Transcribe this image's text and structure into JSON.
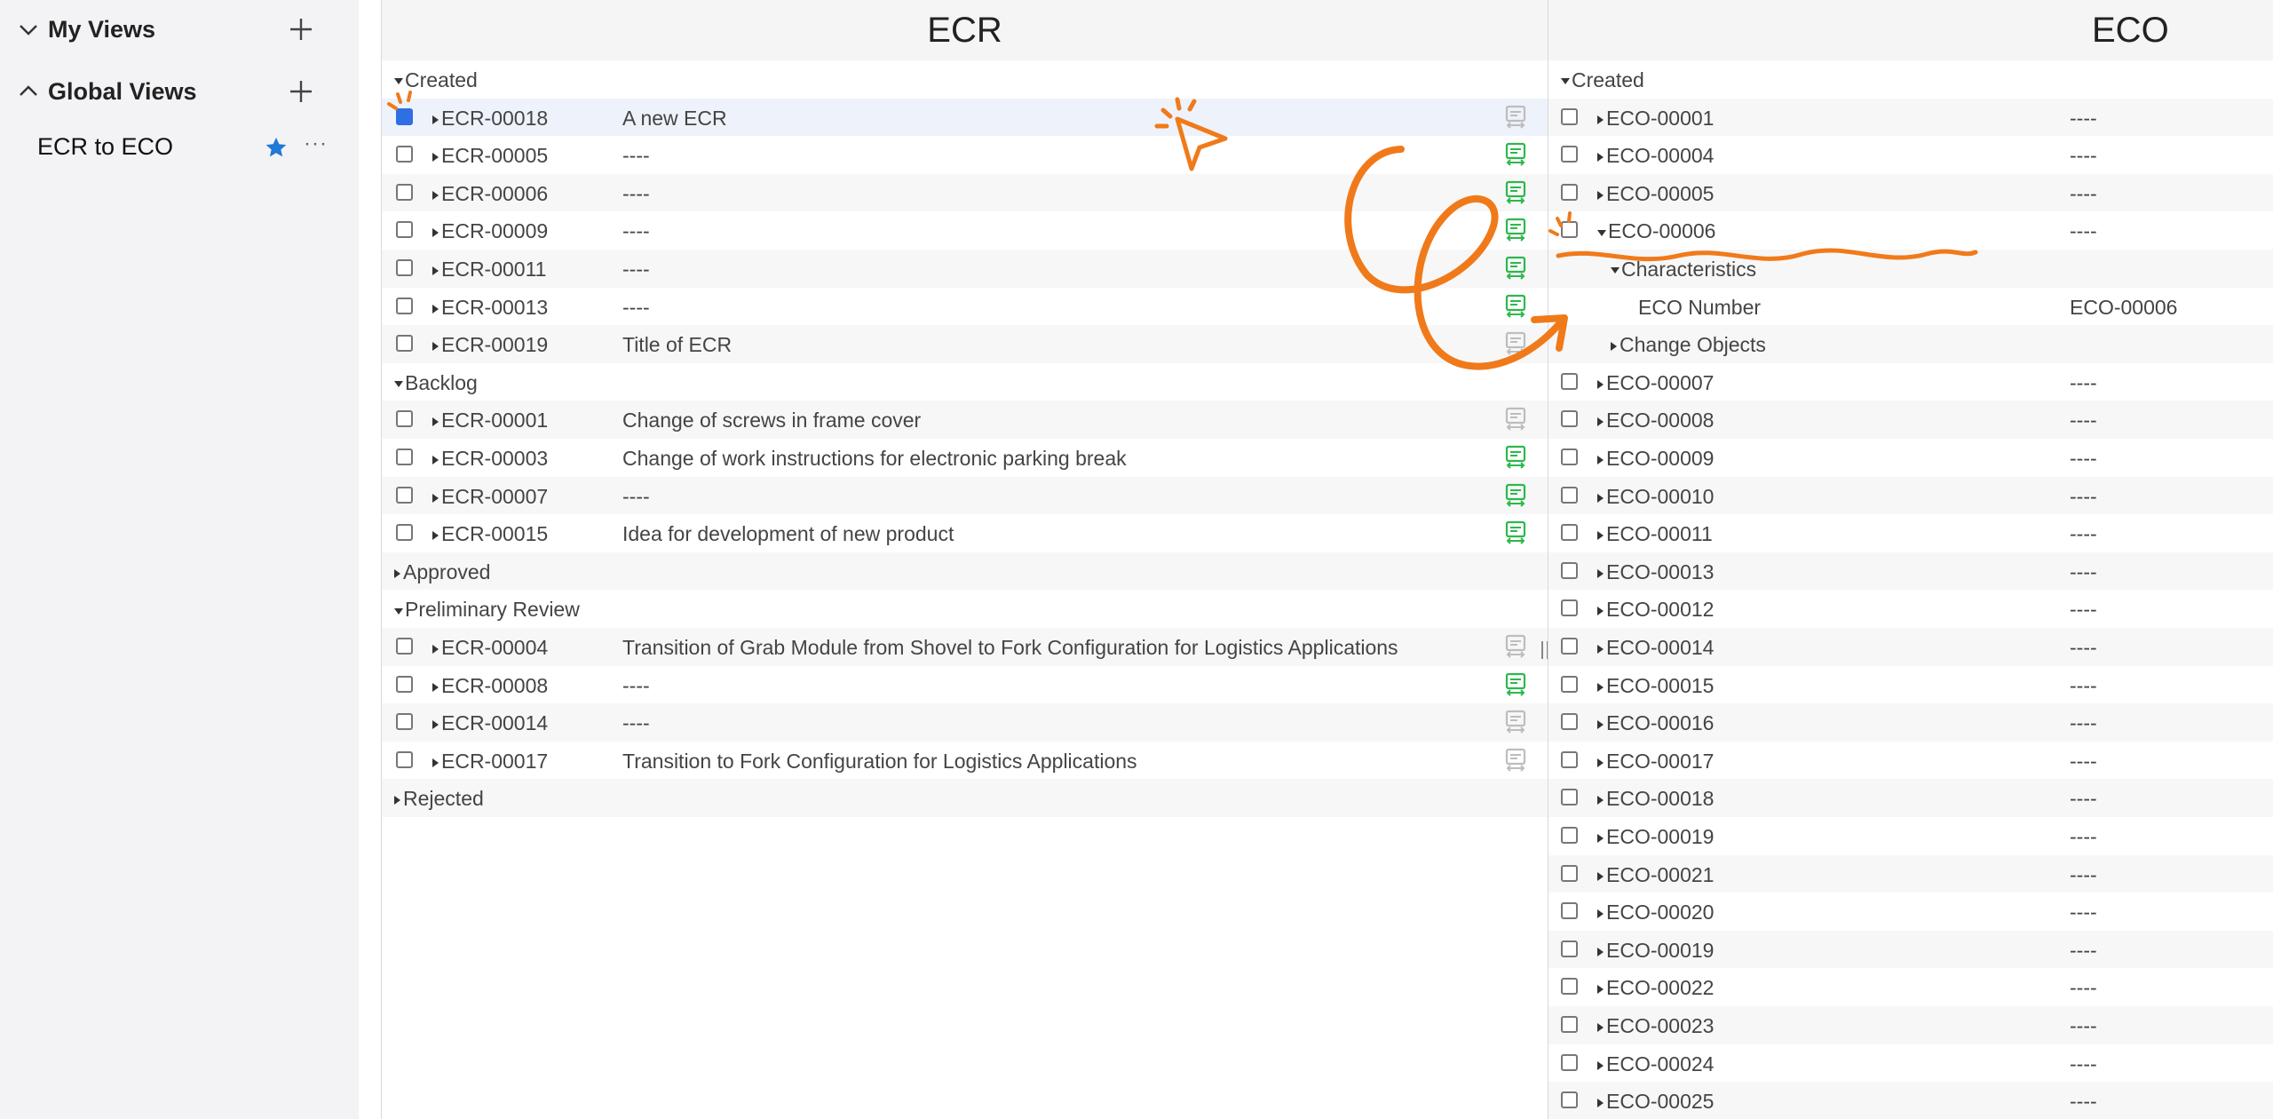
{
  "sidebar": {
    "my_views": {
      "label": "My Views",
      "expanded": false
    },
    "global_views": {
      "label": "Global Views",
      "expanded": true
    },
    "views": [
      {
        "label": "ECR to ECO",
        "favorite": true,
        "more": "···"
      }
    ]
  },
  "ecr_panel": {
    "title": "ECR",
    "rows": [
      {
        "type": "group",
        "label": "Created",
        "expanded": true
      },
      {
        "type": "item",
        "id": "ECR-00018",
        "desc": "A new ECR",
        "checked": true,
        "icon": "gray"
      },
      {
        "type": "item",
        "id": "ECR-00005",
        "desc": "----",
        "checked": false,
        "icon": "green"
      },
      {
        "type": "item",
        "id": "ECR-00006",
        "desc": "----",
        "checked": false,
        "icon": "green"
      },
      {
        "type": "item",
        "id": "ECR-00009",
        "desc": "----",
        "checked": false,
        "icon": "green"
      },
      {
        "type": "item",
        "id": "ECR-00011",
        "desc": "----",
        "checked": false,
        "icon": "green"
      },
      {
        "type": "item",
        "id": "ECR-00013",
        "desc": "----",
        "checked": false,
        "icon": "green"
      },
      {
        "type": "item",
        "id": "ECR-00019",
        "desc": "Title of ECR",
        "checked": false,
        "icon": "gray"
      },
      {
        "type": "group",
        "label": "Backlog",
        "expanded": true
      },
      {
        "type": "item",
        "id": "ECR-00001",
        "desc": "Change of screws in frame cover",
        "checked": false,
        "icon": "gray"
      },
      {
        "type": "item",
        "id": "ECR-00003",
        "desc": "Change of work instructions for electronic parking break",
        "checked": false,
        "icon": "green"
      },
      {
        "type": "item",
        "id": "ECR-00007",
        "desc": "----",
        "checked": false,
        "icon": "green"
      },
      {
        "type": "item",
        "id": "ECR-00015",
        "desc": "Idea for development of new product",
        "checked": false,
        "icon": "green"
      },
      {
        "type": "group",
        "label": "Approved",
        "expanded": false
      },
      {
        "type": "group",
        "label": "Preliminary Review",
        "expanded": true
      },
      {
        "type": "item",
        "id": "ECR-00004",
        "desc": "Transition of Grab Module from Shovel to Fork Configuration for Logistics Applications",
        "checked": false,
        "icon": "gray"
      },
      {
        "type": "item",
        "id": "ECR-00008",
        "desc": "----",
        "checked": false,
        "icon": "green"
      },
      {
        "type": "item",
        "id": "ECR-00014",
        "desc": "----",
        "checked": false,
        "icon": "gray"
      },
      {
        "type": "item",
        "id": "ECR-00017",
        "desc": "Transition to Fork Configuration for Logistics Applications",
        "checked": false,
        "icon": "gray"
      },
      {
        "type": "group",
        "label": "Rejected",
        "expanded": false
      }
    ]
  },
  "eco_panel": {
    "title": "ECO",
    "rows": [
      {
        "type": "group",
        "label": "Created",
        "expanded": true
      },
      {
        "type": "item",
        "id": "ECO-00001",
        "value": "----",
        "checked": false
      },
      {
        "type": "item",
        "id": "ECO-00004",
        "value": "----",
        "checked": false
      },
      {
        "type": "item",
        "id": "ECO-00005",
        "value": "----",
        "checked": false
      },
      {
        "type": "item",
        "id": "ECO-00006",
        "value": "----",
        "checked": false,
        "expanded": true
      },
      {
        "type": "subgroup",
        "label": "Characteristics",
        "expanded": true
      },
      {
        "type": "prop",
        "label": "ECO Number",
        "value": "ECO-00006"
      },
      {
        "type": "subgroup",
        "label": "Change Objects",
        "expanded": false
      },
      {
        "type": "item",
        "id": "ECO-00007",
        "value": "----",
        "checked": false
      },
      {
        "type": "item",
        "id": "ECO-00008",
        "value": "----",
        "checked": false
      },
      {
        "type": "item",
        "id": "ECO-00009",
        "value": "----",
        "checked": false
      },
      {
        "type": "item",
        "id": "ECO-00010",
        "value": "----",
        "checked": false
      },
      {
        "type": "item",
        "id": "ECO-00011",
        "value": "----",
        "checked": false
      },
      {
        "type": "item",
        "id": "ECO-00013",
        "value": "----",
        "checked": false
      },
      {
        "type": "item",
        "id": "ECO-00012",
        "value": "----",
        "checked": false
      },
      {
        "type": "item",
        "id": "ECO-00014",
        "value": "----",
        "checked": false
      },
      {
        "type": "item",
        "id": "ECO-00015",
        "value": "----",
        "checked": false
      },
      {
        "type": "item",
        "id": "ECO-00016",
        "value": "----",
        "checked": false
      },
      {
        "type": "item",
        "id": "ECO-00017",
        "value": "----",
        "checked": false
      },
      {
        "type": "item",
        "id": "ECO-00018",
        "value": "----",
        "checked": false
      },
      {
        "type": "item",
        "id": "ECO-00019",
        "value": "----",
        "checked": false
      },
      {
        "type": "item",
        "id": "ECO-00021",
        "value": "----",
        "checked": false
      },
      {
        "type": "item",
        "id": "ECO-00020",
        "value": "----",
        "checked": false
      },
      {
        "type": "item",
        "id": "ECO-00019",
        "value": "----",
        "checked": false
      },
      {
        "type": "item",
        "id": "ECO-00022",
        "value": "----",
        "checked": false
      },
      {
        "type": "item",
        "id": "ECO-00023",
        "value": "----",
        "checked": false
      },
      {
        "type": "item",
        "id": "ECO-00024",
        "value": "----",
        "checked": false
      },
      {
        "type": "item",
        "id": "ECO-00025",
        "value": "----",
        "checked": false
      }
    ]
  },
  "colors": {
    "accent_blue": "#2f6fe4",
    "star_blue": "#1f7ad6",
    "icon_green": "#2db84d",
    "icon_gray": "#bdbdbd",
    "annotation_orange": "#f07a1a"
  },
  "icons": {
    "convert": "convert-to-eco-icon",
    "star": "star-icon",
    "plus": "plus-icon",
    "chevron_down": "chevron-down-icon",
    "chevron_up": "chevron-up-icon"
  }
}
